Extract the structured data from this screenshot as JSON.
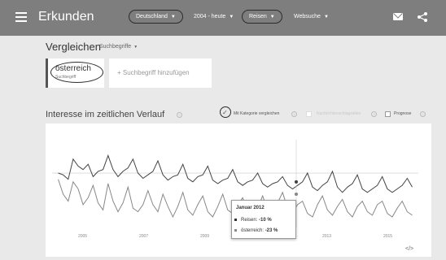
{
  "header": {
    "title": "Erkunden",
    "filters": {
      "region": "Deutschland",
      "time": "2004 - heute",
      "category": "Reisen",
      "search_type": "Websuche"
    }
  },
  "compare": {
    "title": "Vergleichen",
    "subtitle": "Suchbegriffe",
    "term": {
      "name": "österreich",
      "type": "Suchbegriff"
    },
    "add_label": "+ Suchbegriff hinzufügen"
  },
  "interest": {
    "title": "Interesse im zeitlichen Verlauf",
    "compare_category": "Mit Kategorie vergleichen",
    "news_headlines": "Nachrichtenschlagzeilen",
    "forecast": "Prognose"
  },
  "chart_data": {
    "type": "line",
    "x_ticks": [
      "2005",
      "2007",
      "2009",
      "2011",
      "2013",
      "2015"
    ],
    "x_range": [
      2004,
      2016
    ],
    "y_range": [
      0,
      100
    ],
    "grid": false,
    "series": [
      {
        "name": "Reisen",
        "color": "#444444",
        "values": [
          62,
          60,
          55,
          78,
          70,
          66,
          72,
          58,
          64,
          66,
          82,
          66,
          58,
          64,
          68,
          78,
          62,
          56,
          60,
          64,
          76,
          60,
          54,
          58,
          60,
          72,
          56,
          52,
          58,
          60,
          70,
          54,
          50,
          54,
          56,
          66,
          52,
          48,
          52,
          54,
          62,
          50,
          46,
          50,
          52,
          58,
          48,
          44,
          48,
          52,
          62,
          46,
          42,
          48,
          52,
          64,
          46,
          40,
          46,
          50,
          60,
          44,
          40,
          44,
          48,
          58,
          44,
          40,
          44,
          48,
          56,
          46
        ]
      },
      {
        "name": "österreich",
        "color": "#888888",
        "values": [
          55,
          38,
          30,
          52,
          44,
          26,
          34,
          48,
          28,
          20,
          50,
          30,
          18,
          28,
          46,
          22,
          18,
          26,
          42,
          26,
          18,
          38,
          24,
          12,
          24,
          40,
          20,
          14,
          26,
          36,
          18,
          12,
          24,
          38,
          20,
          16,
          26,
          34,
          18,
          14,
          22,
          36,
          20,
          14,
          28,
          40,
          22,
          16,
          26,
          30,
          16,
          12,
          26,
          36,
          20,
          14,
          24,
          32,
          18,
          12,
          24,
          30,
          18,
          14,
          26,
          30,
          16,
          12,
          22,
          30,
          18,
          14
        ]
      }
    ],
    "tooltip": {
      "date": "Januar 2012",
      "rows": [
        {
          "label": "Reisen:",
          "value": "-10 %",
          "color": "#333333"
        },
        {
          "label": "österreich:",
          "value": "-23 %",
          "color": "#888888"
        }
      ]
    }
  },
  "icons": {
    "menu": "menu-icon",
    "mail": "mail-icon",
    "share": "share-icon",
    "embed": "</>"
  }
}
